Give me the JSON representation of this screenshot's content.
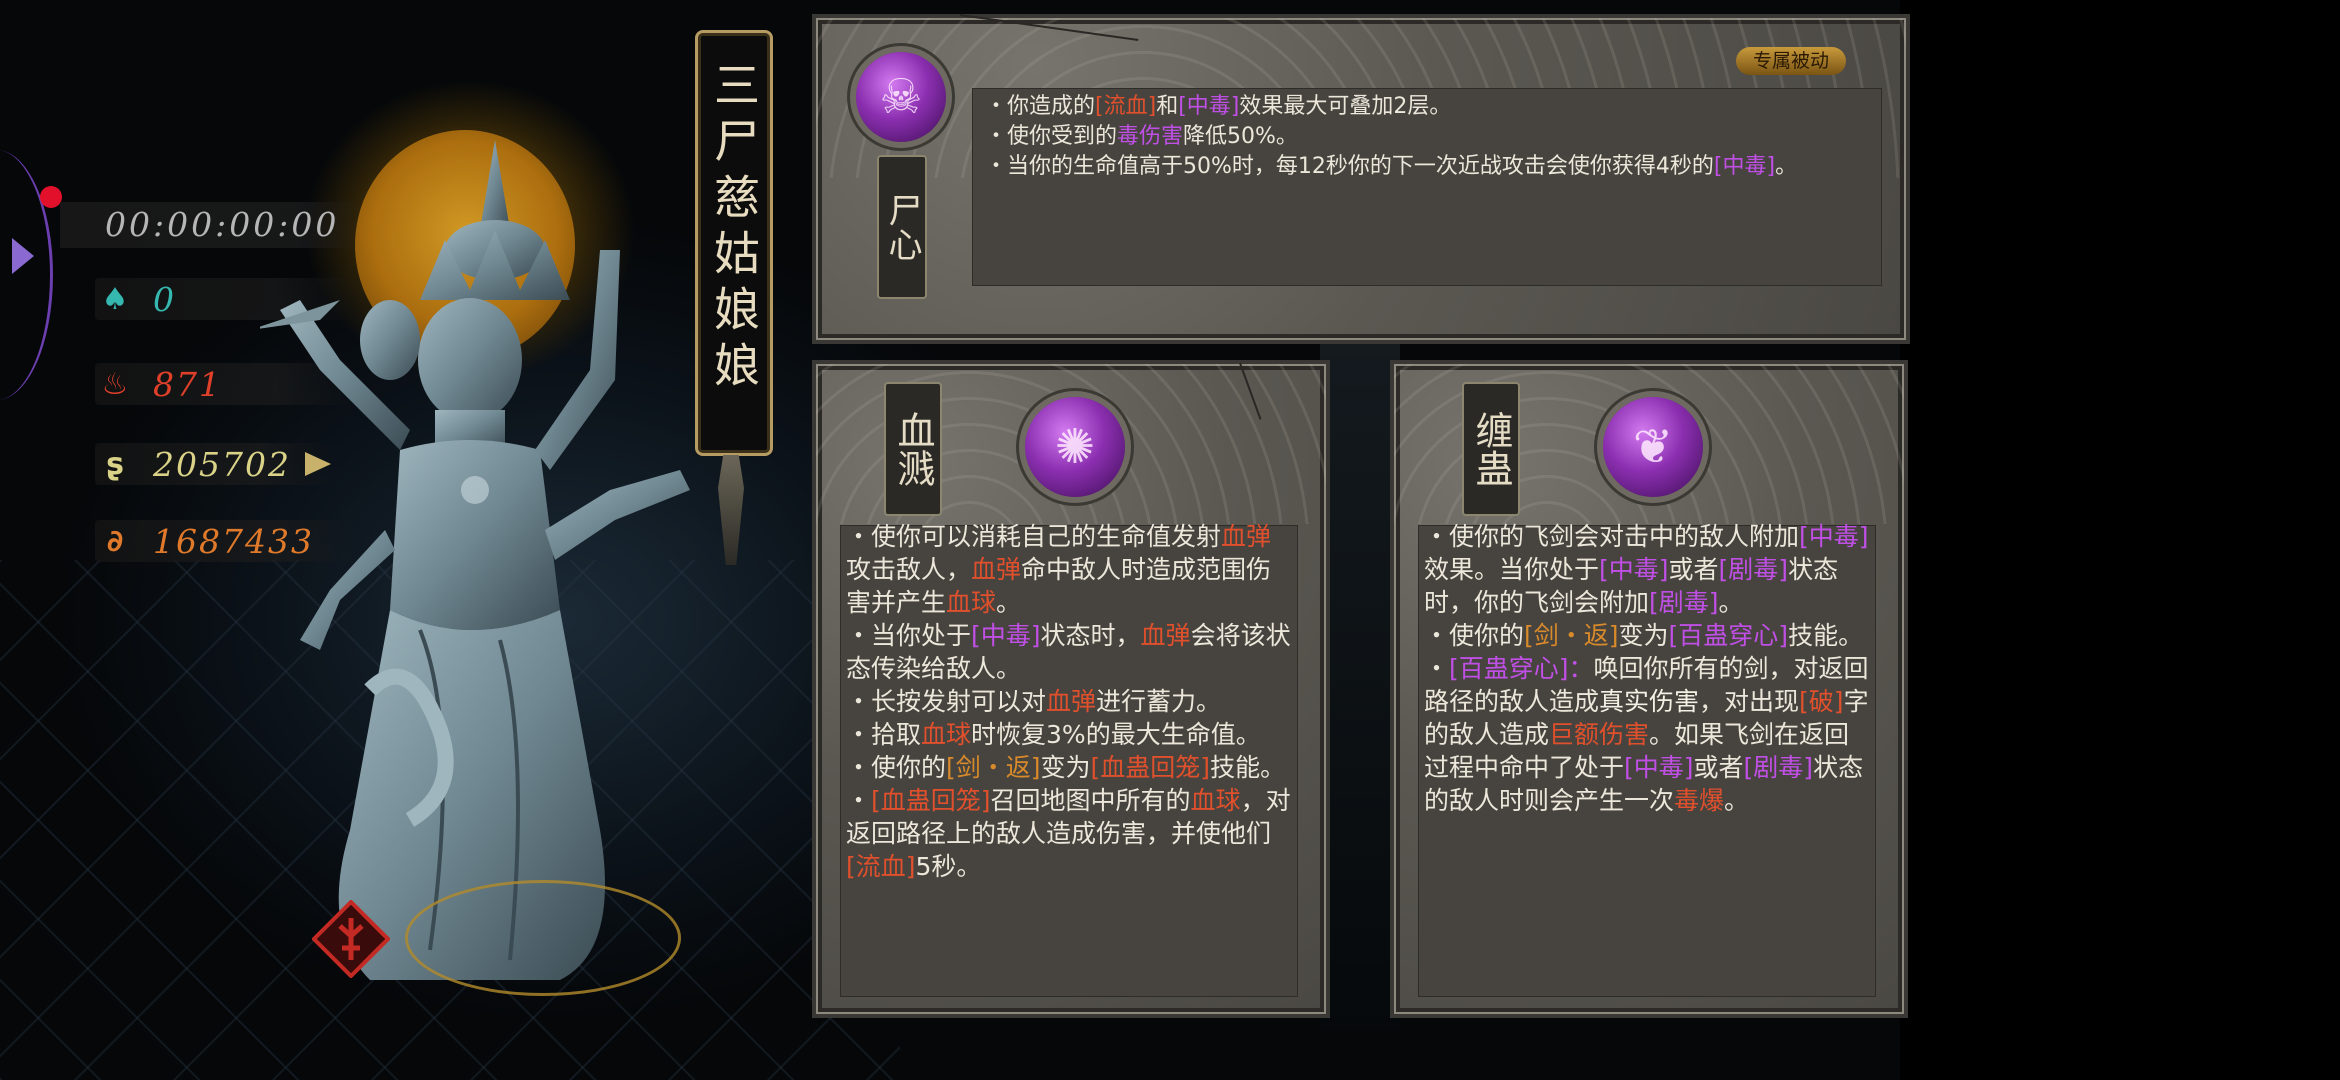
{
  "hud": {
    "timer": "00:00:00:00",
    "stats": [
      {
        "icon": "soul-flame-icon",
        "value": "0",
        "color": "#35b8b0"
      },
      {
        "icon": "fire-icon",
        "value": "871",
        "color": "#e0402a"
      },
      {
        "icon": "spiral-coin-icon",
        "value": "205702",
        "color": "#d9d287"
      },
      {
        "icon": "orange-swirl-icon",
        "value": "1687433",
        "color": "#e07a2a"
      }
    ]
  },
  "title": "三尸慈姑娘娘",
  "exclusive_passive": {
    "tag": "专属被动",
    "name": "尸心",
    "lines": [
      [
        {
          "t": "・你造成的"
        },
        {
          "t": "[流血]",
          "c": "red"
        },
        {
          "t": "和"
        },
        {
          "t": "[中毒]",
          "c": "purple"
        },
        {
          "t": "效果最大可叠加2层。"
        }
      ],
      [
        {
          "t": "・使你受到的"
        },
        {
          "t": "毒伤害",
          "c": "purple"
        },
        {
          "t": "降低50%。"
        }
      ],
      [
        {
          "t": "・当你的生命值高于50%时，每12秒你的下一次近战攻击会使你获得4秒的"
        },
        {
          "t": "[中毒]",
          "c": "purple"
        },
        {
          "t": "。"
        }
      ]
    ]
  },
  "skill_left": {
    "name": "血溅",
    "paragraphs": [
      [
        {
          "t": "・使你可以消耗自己的生命值发射"
        },
        {
          "t": "血弹",
          "c": "red"
        },
        {
          "t": "攻击敌人，"
        },
        {
          "t": "血弹",
          "c": "red"
        },
        {
          "t": "命中敌人时造成范围伤害并产生"
        },
        {
          "t": "血球",
          "c": "red"
        },
        {
          "t": "。"
        }
      ],
      [
        {
          "t": "・当你处于"
        },
        {
          "t": "[中毒]",
          "c": "purple"
        },
        {
          "t": "状态时，"
        },
        {
          "t": "血弹",
          "c": "red"
        },
        {
          "t": "会将该状态传染给敌人。"
        }
      ],
      [
        {
          "t": "・长按发射可以对"
        },
        {
          "t": "血弹",
          "c": "red"
        },
        {
          "t": "进行蓄力。"
        }
      ],
      [
        {
          "t": "・拾取"
        },
        {
          "t": "血球",
          "c": "red"
        },
        {
          "t": "时恢复3%的最大生命值。"
        }
      ],
      [
        {
          "t": "・使你的"
        },
        {
          "t": "[剑・返]",
          "c": "orange"
        },
        {
          "t": "变为"
        },
        {
          "t": "[血蛊回笼]",
          "c": "red"
        },
        {
          "t": "技能。"
        }
      ],
      [
        {
          "t": "・"
        },
        {
          "t": "[血蛊回笼]",
          "c": "red"
        },
        {
          "t": "召回地图中所有的"
        },
        {
          "t": "血球",
          "c": "red"
        },
        {
          "t": "，对返回路径上的敌人造成伤害，并使他们"
        },
        {
          "t": "[流血]",
          "c": "red"
        },
        {
          "t": "5秒。"
        }
      ]
    ]
  },
  "skill_right": {
    "name": "缠蛊",
    "paragraphs": [
      [
        {
          "t": "・使你的飞剑会对击中的敌人附加"
        },
        {
          "t": "[中毒]",
          "c": "purple"
        },
        {
          "t": "效果。当你处于"
        },
        {
          "t": "[中毒]",
          "c": "purple"
        },
        {
          "t": "或者"
        },
        {
          "t": "[剧毒]",
          "c": "purple"
        },
        {
          "t": "状态时，你的飞剑会附加"
        },
        {
          "t": "[剧毒]",
          "c": "purple"
        },
        {
          "t": "。"
        }
      ],
      [
        {
          "t": "・使你的"
        },
        {
          "t": "[剑・返]",
          "c": "orange"
        },
        {
          "t": "变为"
        },
        {
          "t": "[百蛊穿心]",
          "c": "purple"
        },
        {
          "t": "技能。"
        }
      ],
      [
        {
          "t": "・"
        },
        {
          "t": "[百蛊穿心]：",
          "c": "purple"
        },
        {
          "t": "唤回你所有的剑，对返回路径的敌人造成"
        },
        {
          "t": "真实伤害",
          "c": "hl-white"
        },
        {
          "t": "，对出现"
        },
        {
          "t": "[破]",
          "c": "red"
        },
        {
          "t": "字的敌人造成"
        },
        {
          "t": "巨额伤害",
          "c": "red"
        },
        {
          "t": "。如果飞剑在返回过程中命中了处于"
        },
        {
          "t": "[中毒]",
          "c": "purple"
        },
        {
          "t": "或者"
        },
        {
          "t": "[剧毒]",
          "c": "purple"
        },
        {
          "t": "状态的敌人时则会产生一次"
        },
        {
          "t": "毒爆",
          "c": "red"
        },
        {
          "t": "。"
        }
      ]
    ]
  },
  "colors": {
    "red": "#e0502c",
    "purple": "#c04fe6",
    "orange": "#d98a2a",
    "gold": "#b69c62"
  }
}
